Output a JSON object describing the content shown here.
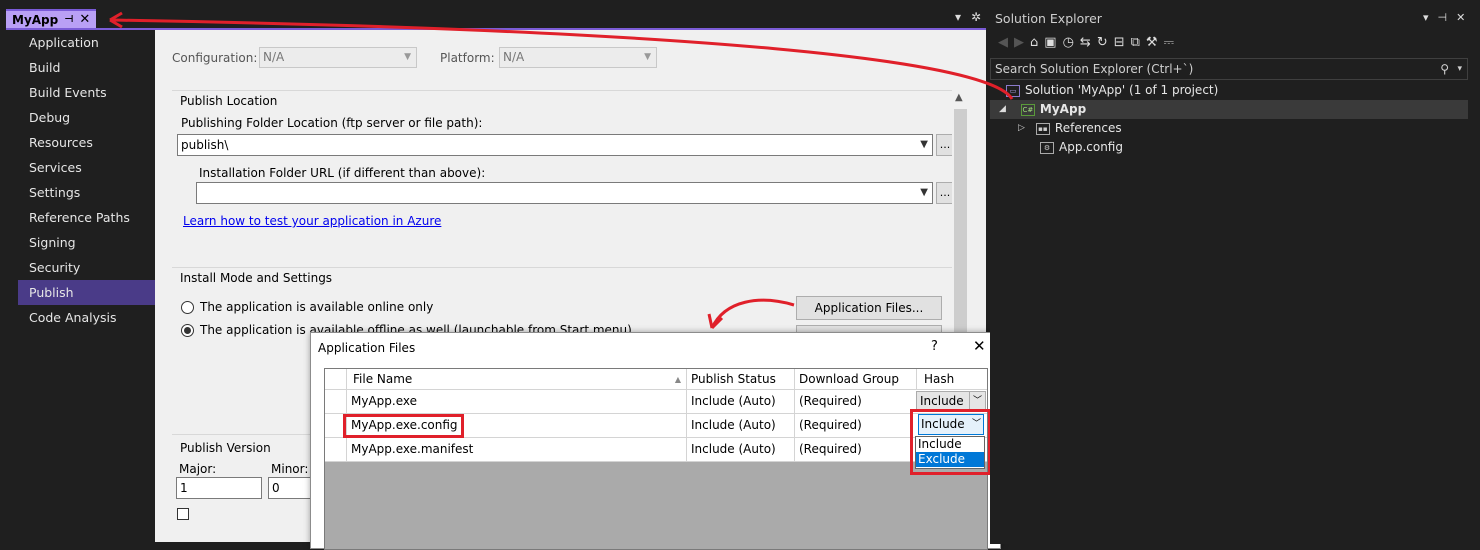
{
  "doc_tab": {
    "title": "MyApp",
    "pin": "⊣",
    "close": "✕"
  },
  "tab_tools": {
    "dropdown": "▾",
    "settings": "✲"
  },
  "nav": {
    "items": [
      "Application",
      "Build",
      "Build Events",
      "Debug",
      "Resources",
      "Services",
      "Settings",
      "Reference Paths",
      "Signing",
      "Security",
      "Publish",
      "Code Analysis"
    ],
    "active": "Publish"
  },
  "props": {
    "configuration_label": "Configuration:",
    "configuration_value": "N/A",
    "platform_label": "Platform:",
    "platform_value": "N/A",
    "publish_location_title": "Publish Location",
    "folder_location_label": "Publishing Folder Location (ftp server or file path):",
    "folder_location_value": "publish\\",
    "install_url_label": "Installation Folder URL (if different than above):",
    "install_url_value": "",
    "browse_label": "...",
    "azure_link": "Learn how to test your application in Azure",
    "install_mode_title": "Install Mode and Settings",
    "radio_online": "The application is available online only",
    "radio_offline": "The application is available offline as well (launchable from Start menu)",
    "app_files_button": "Application Files...",
    "publish_version_title": "Publish Version",
    "major_label": "Major:",
    "major_value": "1",
    "minor_label": "Minor:",
    "minor_value": "0"
  },
  "dialog": {
    "title": "Application Files",
    "help": "?",
    "close": "✕",
    "columns": [
      "File Name",
      "Publish Status",
      "Download Group",
      "Hash"
    ],
    "sort_glyph": "▲",
    "rows": [
      {
        "file": "MyApp.exe",
        "status": "Include (Auto)",
        "group": "(Required)",
        "hash": "Include"
      },
      {
        "file": "MyApp.exe.config",
        "status": "Include (Auto)",
        "group": "(Required)",
        "hash": "Include"
      },
      {
        "file": "MyApp.exe.manifest",
        "status": "Include (Auto)",
        "group": "(Required)",
        "hash": ""
      }
    ],
    "hash_options": [
      "Include",
      "Exclude"
    ],
    "hash_selected_option": "Exclude"
  },
  "solution_explorer": {
    "title": "Solution Explorer",
    "title_tools": [
      "▾",
      "⊣",
      "✕"
    ],
    "search_placeholder": "Search Solution Explorer (Ctrl+`)",
    "tree": {
      "solution": "Solution 'MyApp' (1 of 1 project)",
      "project": "MyApp",
      "references": "References",
      "config": "App.config"
    }
  },
  "colors": {
    "accent": "#7b5cd6",
    "highlight_red": "#e0202a",
    "selection_blue": "#0078d7"
  }
}
